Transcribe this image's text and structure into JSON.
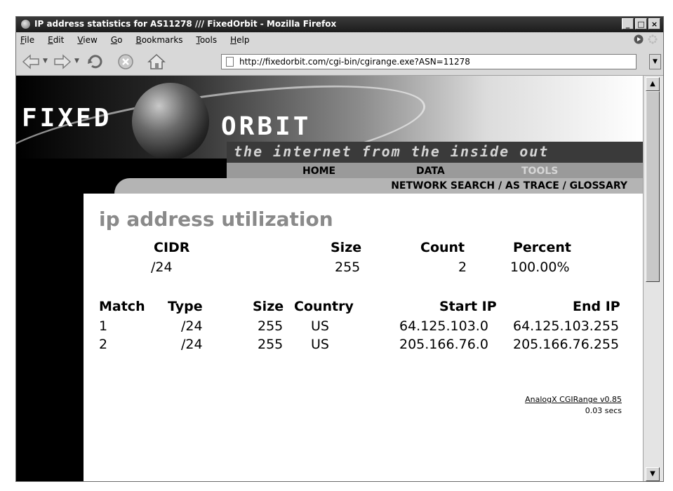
{
  "window": {
    "title": "IP address statistics for AS11278 /// FixedOrbit - Mozilla Firefox",
    "minimize": "_",
    "maximize": "□",
    "close": "×"
  },
  "menu": {
    "items": [
      "File",
      "Edit",
      "View",
      "Go",
      "Bookmarks",
      "Tools",
      "Help"
    ]
  },
  "toolbar": {
    "back_icon": "back-arrow-icon",
    "forward_icon": "forward-arrow-icon",
    "reload_icon": "reload-icon",
    "stop_icon": "stop-icon",
    "home_icon": "home-icon",
    "url": "http://fixedorbit.com/cgi-bin/cgirange.exe?ASN=11278"
  },
  "site": {
    "logo_left": "FIXED",
    "logo_right": "ORBIT",
    "tagline": "the internet from the inside out",
    "nav_primary": [
      "HOME",
      "DATA",
      "TOOLS"
    ],
    "nav_secondary": "NETWORK SEARCH / AS TRACE / GLOSSARY"
  },
  "main": {
    "title": "ip address utilization",
    "summary": {
      "headers": [
        "CIDR",
        "Size",
        "Count",
        "Percent"
      ],
      "row": [
        "/24",
        "255",
        "2",
        "100.00%"
      ]
    },
    "detail": {
      "headers": [
        "Match",
        "Type",
        "Size",
        "Country",
        "Start IP",
        "End IP"
      ],
      "rows": [
        [
          "1",
          "/24",
          "255",
          "US",
          "64.125.103.0",
          "64.125.103.255"
        ],
        [
          "2",
          "/24",
          "255",
          "US",
          "205.166.76.0",
          "205.166.76.255"
        ]
      ]
    },
    "footer_link": "AnalogX CGIRange v0.85",
    "footer_time": "0.03 secs"
  }
}
